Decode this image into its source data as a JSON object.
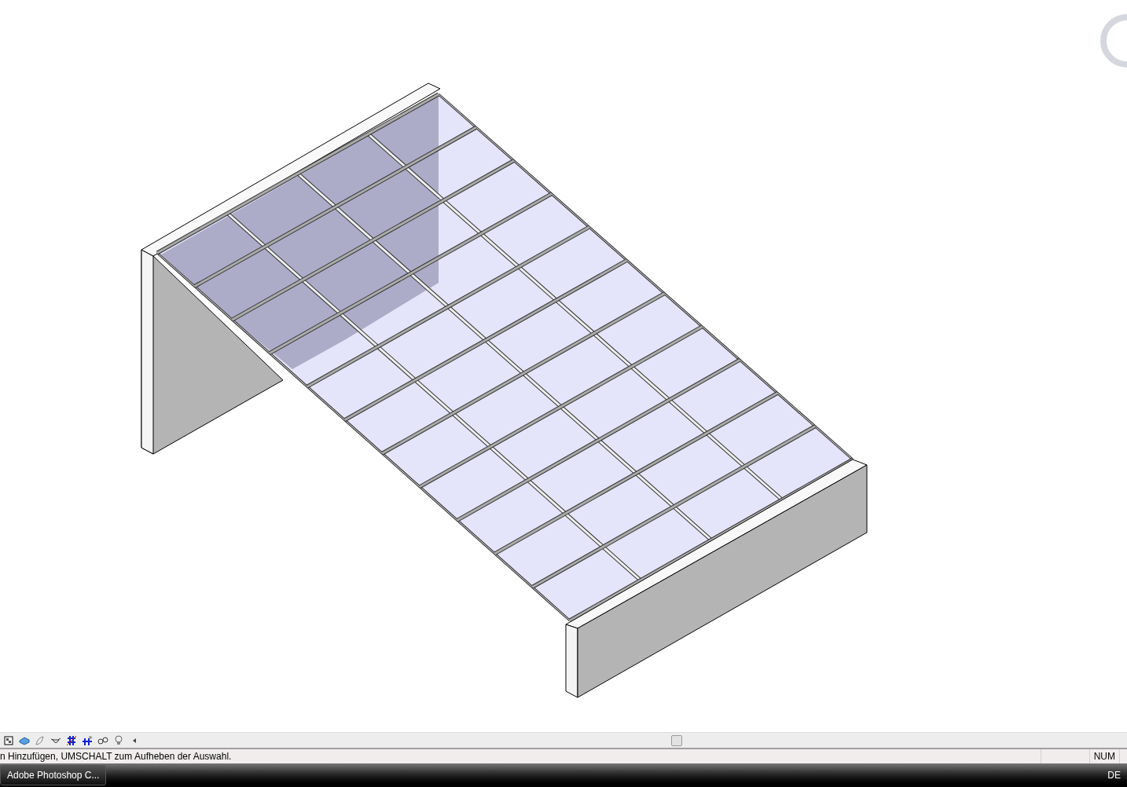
{
  "status_bar": {
    "message": "n Hinzufügen, UMSCHALT zum Aufheben der Auswahl.",
    "indicators": [
      "NUM"
    ]
  },
  "taskbar": {
    "buttons": [
      {
        "label": "Adobe Photoshop C..."
      }
    ],
    "language": "DE"
  }
}
